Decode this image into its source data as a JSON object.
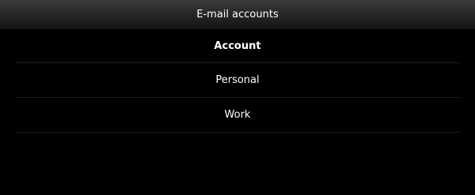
{
  "window": {
    "title": "E-mail accounts"
  },
  "list": {
    "header_label": "Account",
    "items": [
      {
        "label": "Personal"
      },
      {
        "label": "Work"
      }
    ]
  },
  "colors": {
    "background": "#000000",
    "text": "#ffffff",
    "divider": "#0c2233",
    "title_bar_top": "#3c3c3c",
    "title_bar_bottom": "#141414"
  }
}
